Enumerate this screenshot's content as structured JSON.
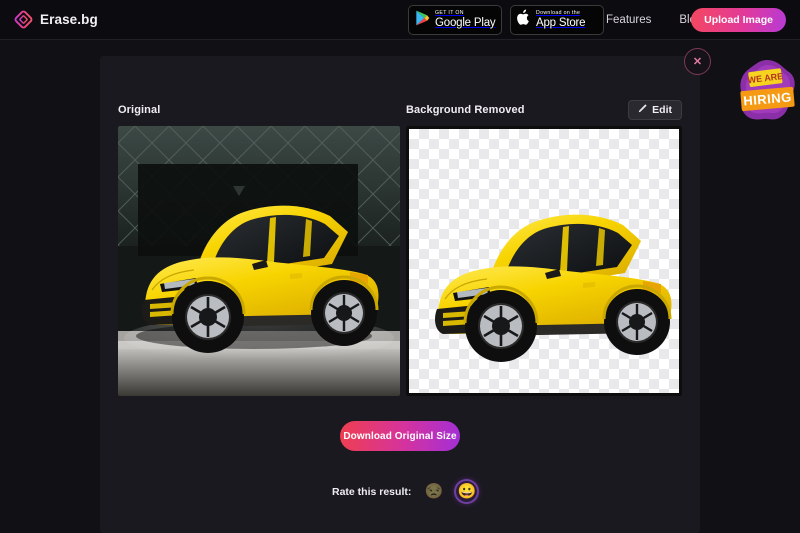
{
  "header": {
    "brand_name": "Erase.bg",
    "brand_logo_icon": "diamond-logo-icon",
    "store_badges": [
      {
        "icon": "google-play-icon",
        "top_label": "GET IT ON",
        "bottom_label": "Google Play"
      },
      {
        "icon": "apple-icon",
        "top_label": "Download on the",
        "bottom_label": "App Store"
      }
    ],
    "nav": [
      {
        "label": "Features"
      },
      {
        "label": "Blog"
      }
    ],
    "upload_button": "Upload Image"
  },
  "overlay": {
    "close_icon": "close-x-icon",
    "close_label": "✕",
    "hiring_badge": {
      "line1": "WE ARE",
      "line2": "HIRING"
    }
  },
  "main": {
    "panels": [
      {
        "title": "Original",
        "image_alt": "yellow-lamborghini-urus-on-dark-showroom-stage"
      },
      {
        "title": "Background Removed",
        "image_alt": "yellow-lamborghini-urus-cutout-on-transparent-checkerboard"
      }
    ],
    "edit_button": {
      "label": "Edit",
      "icon": "pencil-icon"
    },
    "download_button": "Download Original Size",
    "rating": {
      "label": "Rate this result:",
      "options": [
        {
          "name": "unhappy",
          "glyph": "😒",
          "selected": false
        },
        {
          "name": "happy",
          "glyph": "😀",
          "selected": true
        }
      ]
    }
  },
  "colors": {
    "page_bg": "#111014",
    "card_bg": "#1b1920",
    "header_bg": "#0c0b0f",
    "accent_pink": "#e2399a",
    "accent_red": "#f4485f",
    "accent_purple": "#b63bd6",
    "car_yellow": "#f5d000"
  }
}
